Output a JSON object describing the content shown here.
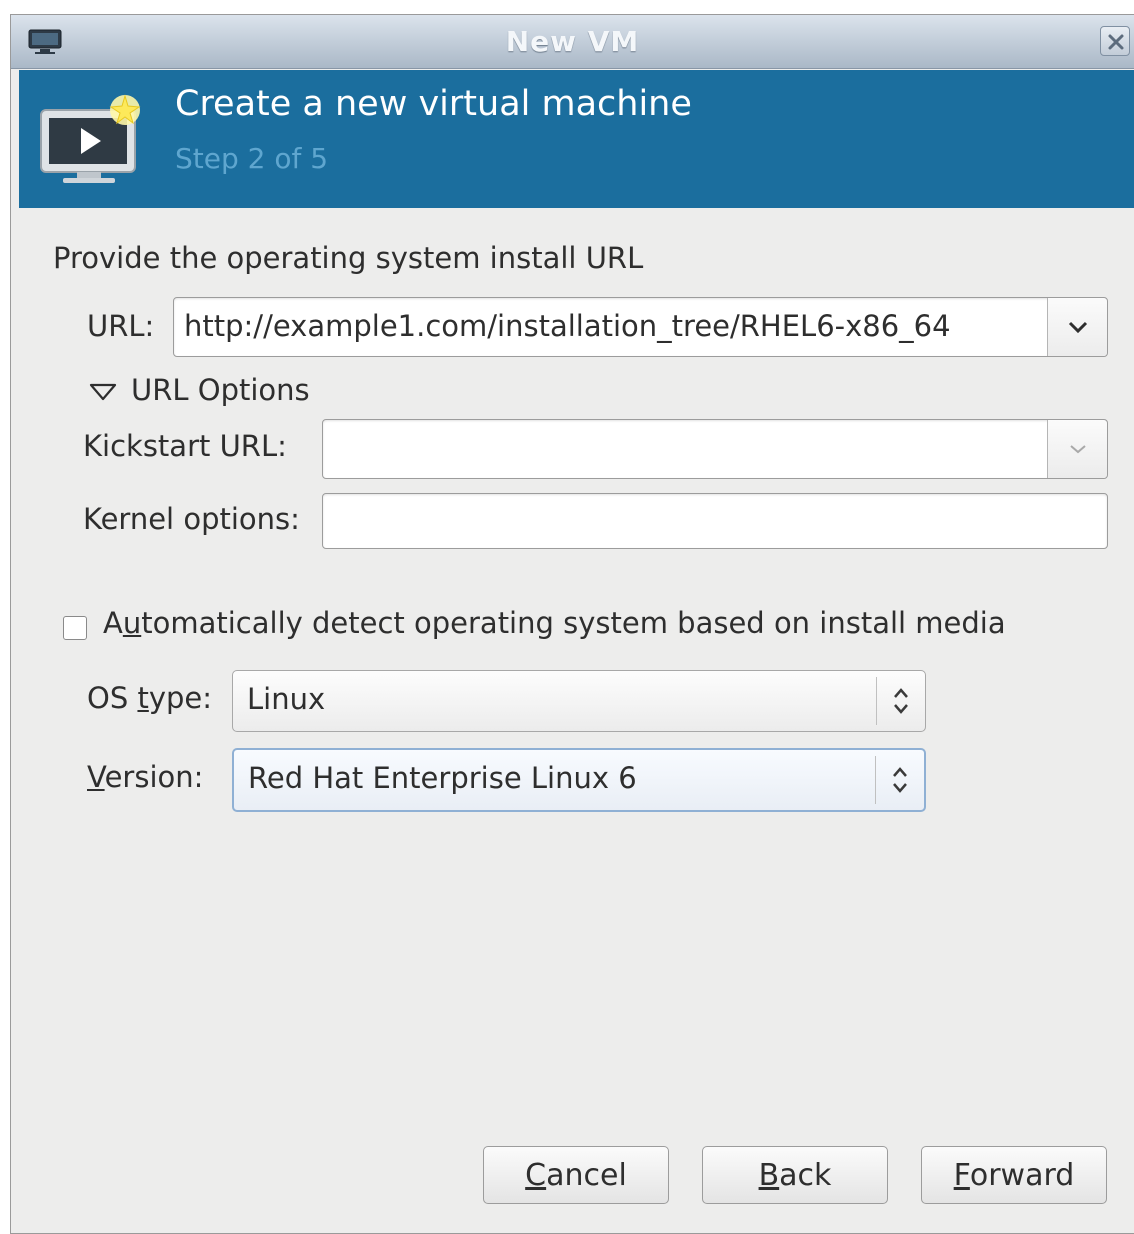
{
  "window": {
    "title": "New VM"
  },
  "banner": {
    "heading": "Create a new virtual machine",
    "step": "Step 2 of 5"
  },
  "section": {
    "heading": "Provide the operating system install URL"
  },
  "url": {
    "label": "URL:",
    "value": "http://example1.com/installation_tree/RHEL6-x86_64"
  },
  "url_options": {
    "label": "URL Options",
    "kickstart_label": "Kickstart URL:",
    "kickstart_value": "",
    "kernel_label": "Kernel options:",
    "kernel_value": ""
  },
  "auto_detect": {
    "checked": false,
    "pre": "A",
    "mnemonic": "u",
    "post": "tomatically detect operating system based on install media"
  },
  "os_type": {
    "pre": "OS ",
    "mnemonic": "t",
    "post": "ype:",
    "value": "Linux"
  },
  "version": {
    "pre": "",
    "mnemonic": "V",
    "post": "ersion:",
    "value": "Red Hat Enterprise Linux 6"
  },
  "buttons": {
    "cancel": {
      "mnemonic": "C",
      "rest": "ancel"
    },
    "back": {
      "mnemonic": "B",
      "rest": "ack"
    },
    "forward": {
      "mnemonic": "F",
      "rest": "orward"
    }
  },
  "colors": {
    "banner": "#1b6e9e",
    "step_text": "#5fa6cf",
    "window_bg": "#ededec"
  },
  "icons": [
    "vm-monitor-icon",
    "close-icon",
    "chevron-down-icon",
    "triangle-down-icon",
    "up-down-arrows-icon"
  ]
}
